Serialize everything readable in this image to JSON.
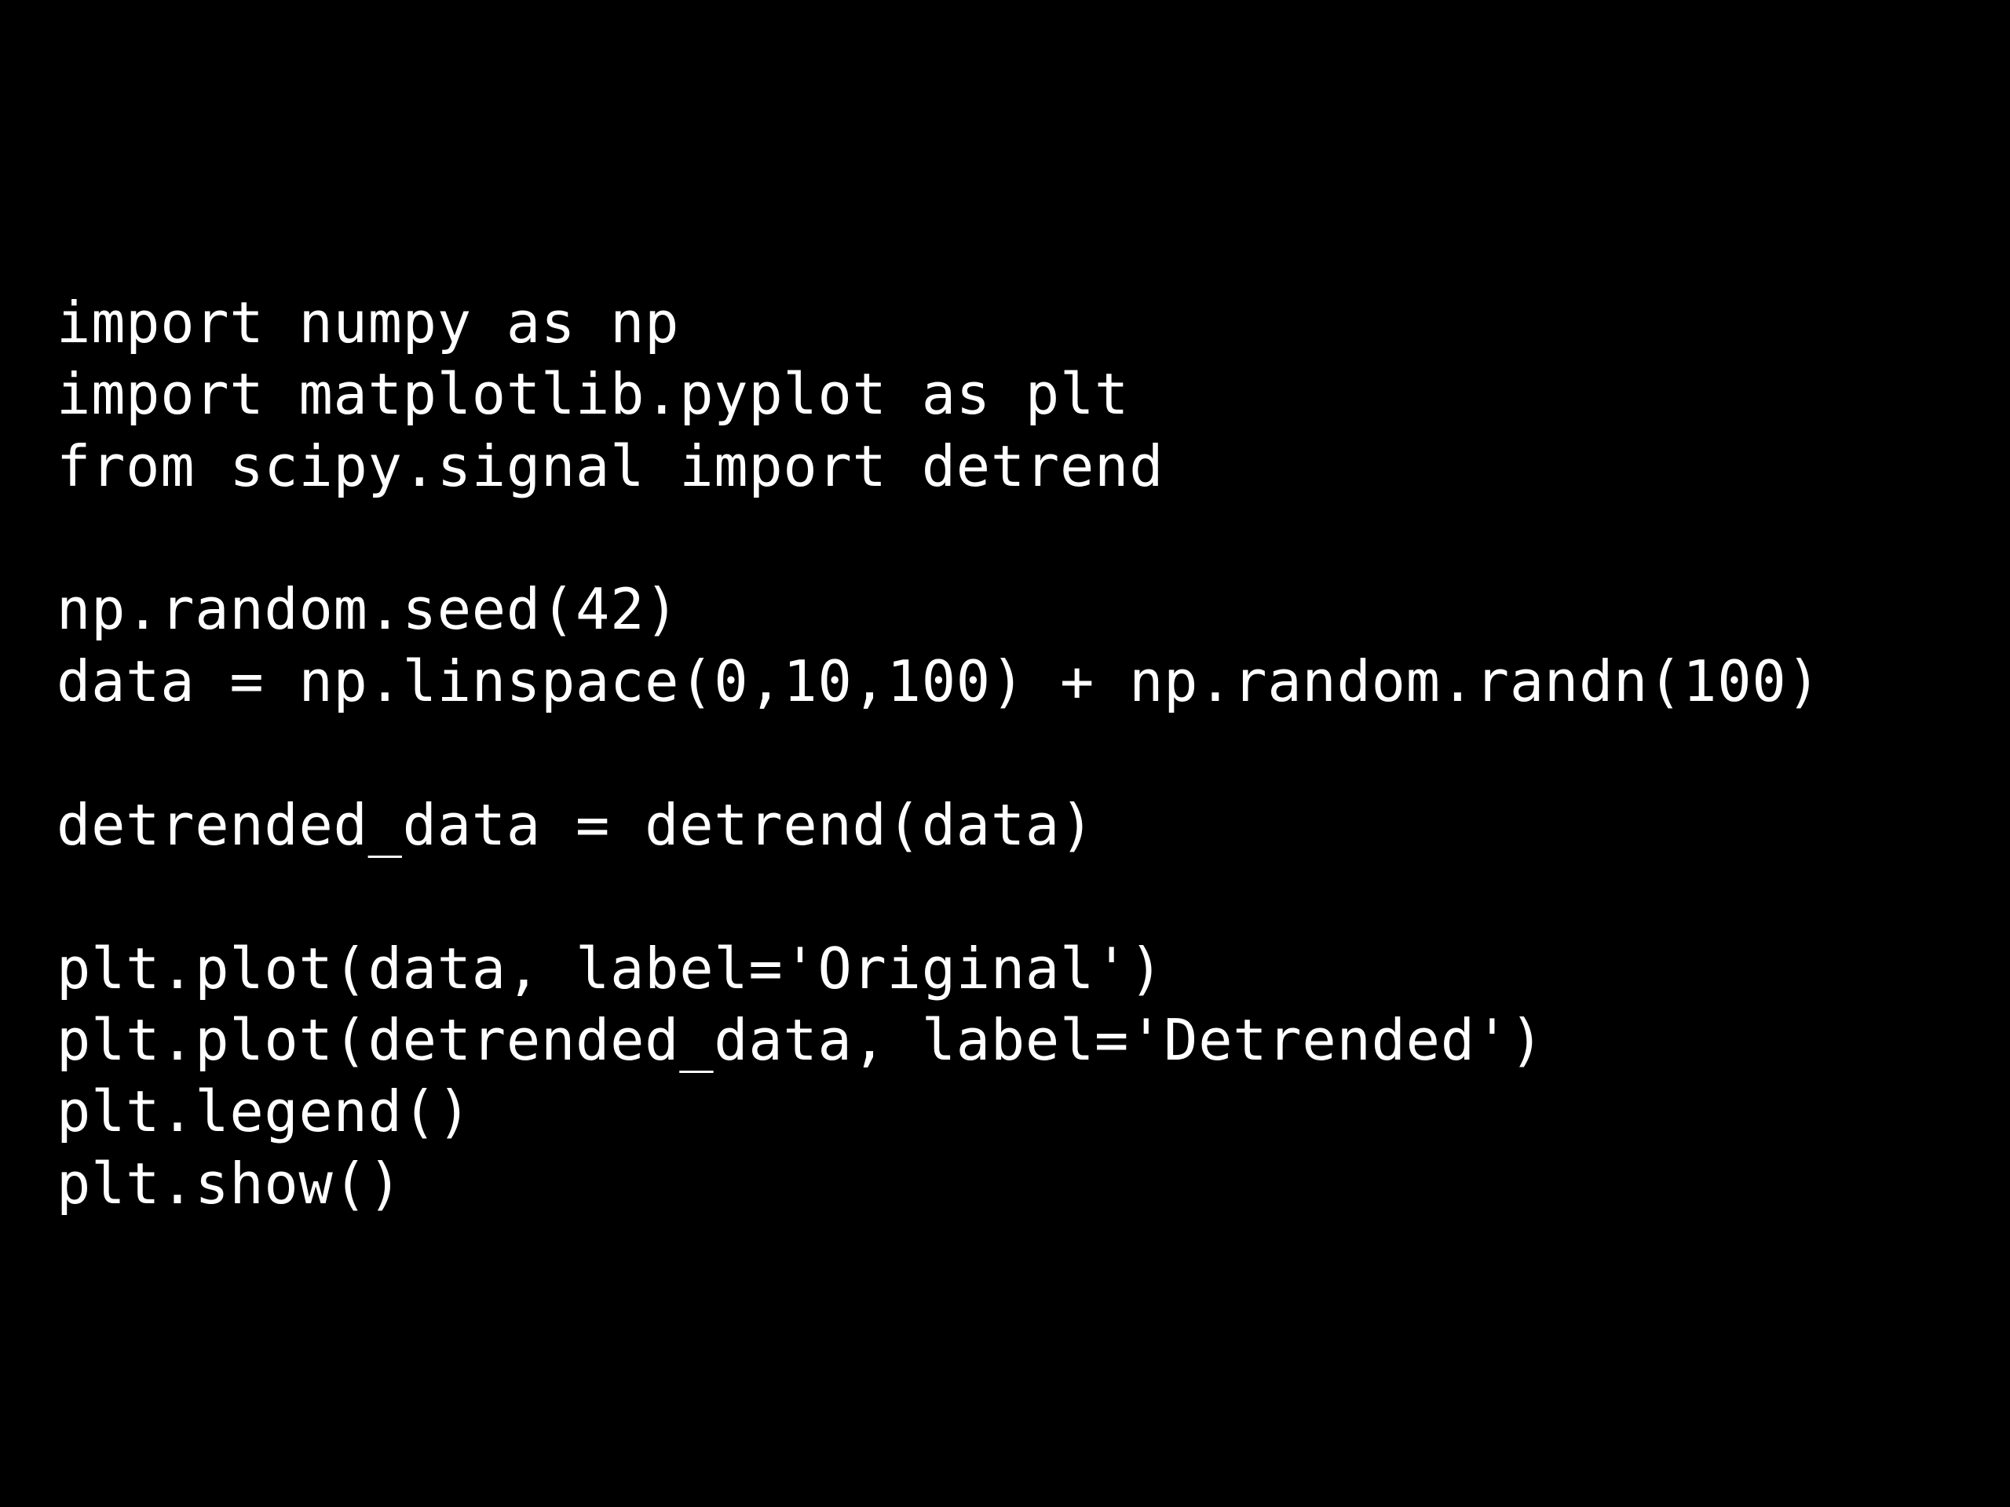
{
  "code": {
    "lines": [
      "import numpy as np",
      "import matplotlib.pyplot as plt",
      "from scipy.signal import detrend",
      "",
      "np.random.seed(42)",
      "data = np.linspace(0,10,100) + np.random.randn(100)",
      "",
      "detrended_data = detrend(data)",
      "",
      "plt.plot(data, label='Original')",
      "plt.plot(detrended_data, label='Detrended')",
      "plt.legend()",
      "plt.show()"
    ]
  }
}
